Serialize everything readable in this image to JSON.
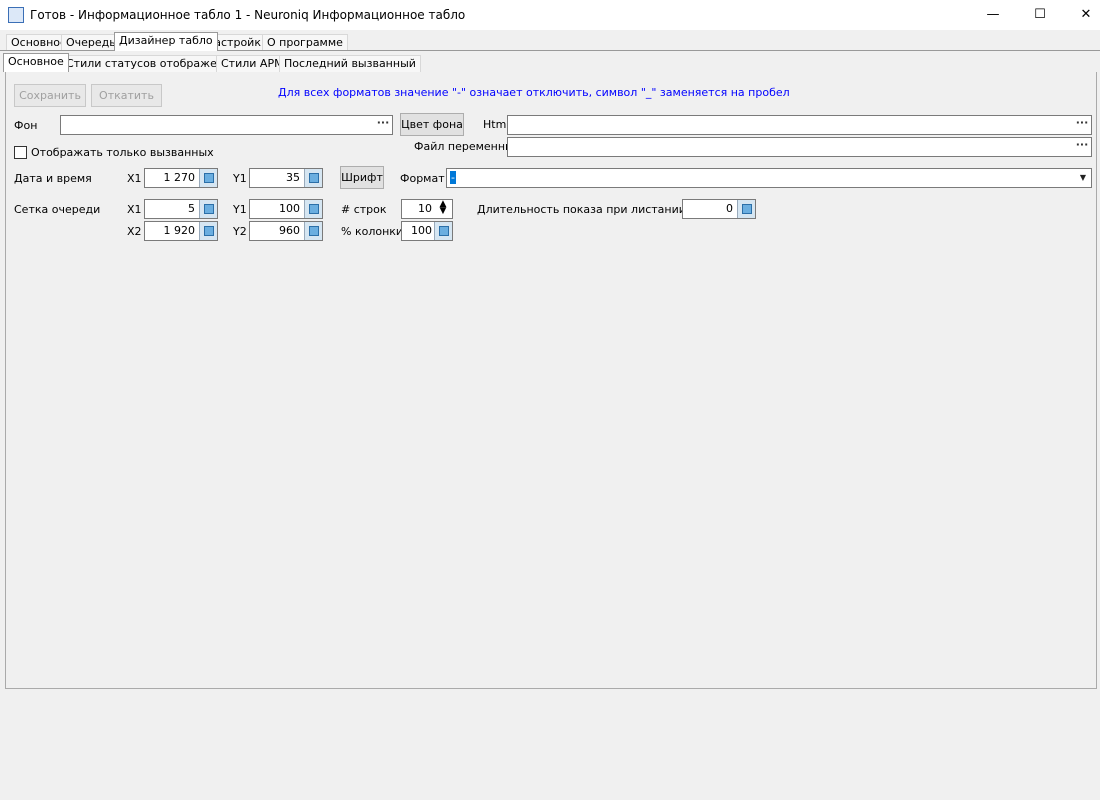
{
  "window": {
    "title": "Готов - Информационное табло 1 - Neuroniq Информационное табло",
    "minimize": "—",
    "maximize": "☐",
    "close": "✕"
  },
  "main_tabs": [
    "Основное",
    "Очередь",
    "Дизайнер табло",
    "Настройки",
    "О программе"
  ],
  "sub_tabs": [
    "Основное",
    "Стили статусов отображения",
    "Стили АРМ",
    "Последний вызванный"
  ],
  "toolbar": {
    "save": "Сохранить",
    "rollback": "Откатить",
    "hint": "Для всех форматов значение \"-\" означает отключить, символ \"_\" заменяется на пробел"
  },
  "fon": {
    "label": "Фон",
    "value": "",
    "bg_color_btn": "Цвет фона",
    "html_label": "Html",
    "html_value": "",
    "varfile_label": "Файл переменных",
    "varfile_value": ""
  },
  "only_called": "Отображать только вызванных",
  "datetime": {
    "label": "Дата и время",
    "x1_label": "X1",
    "x1": "1 270",
    "y1_label": "Y1",
    "y1": "35",
    "font_btn": "Шрифт",
    "format_label": "Формат",
    "format_value": "-"
  },
  "grid": {
    "label": "Сетка очереди",
    "x1_label": "X1",
    "x1": "5",
    "y1_label": "Y1",
    "y1": "100",
    "rows_label": "# строк",
    "rows": "10",
    "duration_label": "Длительность показа при листании (сек)",
    "duration": "0",
    "x2_label": "X2",
    "x2": "1 920",
    "y2_label": "Y2",
    "y2": "960",
    "pct_label": "% колонки",
    "pct": "100"
  }
}
